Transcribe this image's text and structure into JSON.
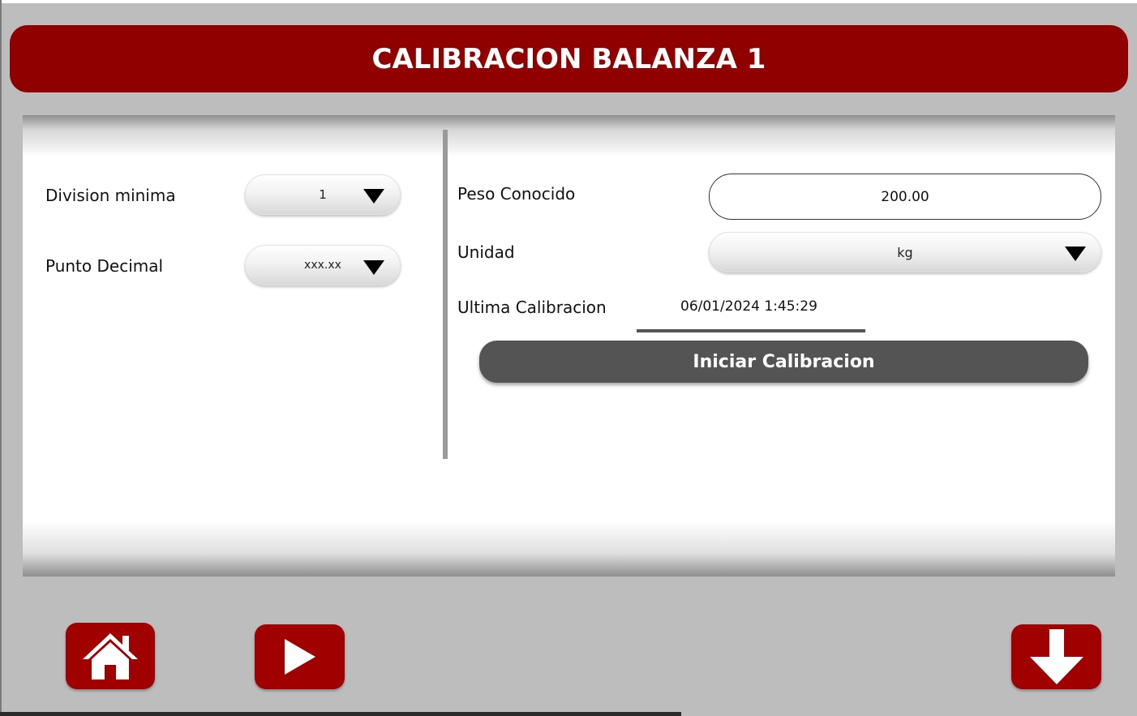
{
  "header": {
    "title": "CALIBRACION BALANZA 1"
  },
  "left_panel": {
    "division_minima": {
      "label": "Division minima",
      "value": "1"
    },
    "punto_decimal": {
      "label": "Punto Decimal",
      "value": "xxx.xx"
    }
  },
  "right_panel": {
    "peso_conocido": {
      "label": "Peso Conocido",
      "value": "200.00"
    },
    "unidad": {
      "label": "Unidad",
      "value": "kg"
    },
    "ultima_calibracion": {
      "label": "Ultima Calibracion",
      "value": "06/01/2024 1:45:29"
    },
    "start_button_label": "Iniciar Calibracion"
  },
  "nav": {
    "home_icon": "home-icon",
    "play_icon": "play-icon",
    "down_icon": "arrow-down-icon"
  },
  "colors": {
    "brand_red": "#900000",
    "nav_red": "#a10000",
    "button_gray": "#545454",
    "background": "#bdbdbd"
  }
}
